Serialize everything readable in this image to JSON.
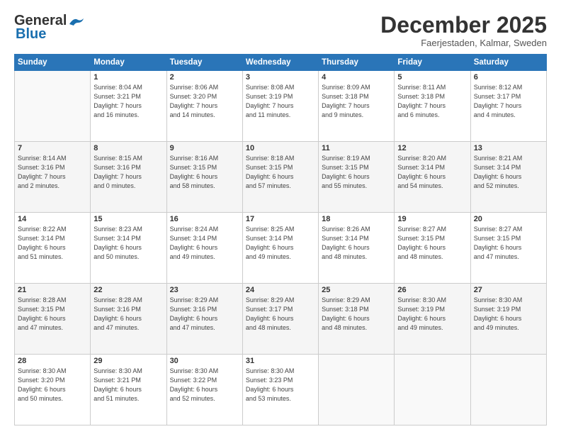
{
  "logo": {
    "line1": "General",
    "line2": "Blue"
  },
  "title": "December 2025",
  "location": "Faerjestaden, Kalmar, Sweden",
  "days_header": [
    "Sunday",
    "Monday",
    "Tuesday",
    "Wednesday",
    "Thursday",
    "Friday",
    "Saturday"
  ],
  "weeks": [
    [
      {
        "num": "",
        "info": ""
      },
      {
        "num": "1",
        "info": "Sunrise: 8:04 AM\nSunset: 3:21 PM\nDaylight: 7 hours\nand 16 minutes."
      },
      {
        "num": "2",
        "info": "Sunrise: 8:06 AM\nSunset: 3:20 PM\nDaylight: 7 hours\nand 14 minutes."
      },
      {
        "num": "3",
        "info": "Sunrise: 8:08 AM\nSunset: 3:19 PM\nDaylight: 7 hours\nand 11 minutes."
      },
      {
        "num": "4",
        "info": "Sunrise: 8:09 AM\nSunset: 3:18 PM\nDaylight: 7 hours\nand 9 minutes."
      },
      {
        "num": "5",
        "info": "Sunrise: 8:11 AM\nSunset: 3:18 PM\nDaylight: 7 hours\nand 6 minutes."
      },
      {
        "num": "6",
        "info": "Sunrise: 8:12 AM\nSunset: 3:17 PM\nDaylight: 7 hours\nand 4 minutes."
      }
    ],
    [
      {
        "num": "7",
        "info": "Sunrise: 8:14 AM\nSunset: 3:16 PM\nDaylight: 7 hours\nand 2 minutes."
      },
      {
        "num": "8",
        "info": "Sunrise: 8:15 AM\nSunset: 3:16 PM\nDaylight: 7 hours\nand 0 minutes."
      },
      {
        "num": "9",
        "info": "Sunrise: 8:16 AM\nSunset: 3:15 PM\nDaylight: 6 hours\nand 58 minutes."
      },
      {
        "num": "10",
        "info": "Sunrise: 8:18 AM\nSunset: 3:15 PM\nDaylight: 6 hours\nand 57 minutes."
      },
      {
        "num": "11",
        "info": "Sunrise: 8:19 AM\nSunset: 3:15 PM\nDaylight: 6 hours\nand 55 minutes."
      },
      {
        "num": "12",
        "info": "Sunrise: 8:20 AM\nSunset: 3:14 PM\nDaylight: 6 hours\nand 54 minutes."
      },
      {
        "num": "13",
        "info": "Sunrise: 8:21 AM\nSunset: 3:14 PM\nDaylight: 6 hours\nand 52 minutes."
      }
    ],
    [
      {
        "num": "14",
        "info": "Sunrise: 8:22 AM\nSunset: 3:14 PM\nDaylight: 6 hours\nand 51 minutes."
      },
      {
        "num": "15",
        "info": "Sunrise: 8:23 AM\nSunset: 3:14 PM\nDaylight: 6 hours\nand 50 minutes."
      },
      {
        "num": "16",
        "info": "Sunrise: 8:24 AM\nSunset: 3:14 PM\nDaylight: 6 hours\nand 49 minutes."
      },
      {
        "num": "17",
        "info": "Sunrise: 8:25 AM\nSunset: 3:14 PM\nDaylight: 6 hours\nand 49 minutes."
      },
      {
        "num": "18",
        "info": "Sunrise: 8:26 AM\nSunset: 3:14 PM\nDaylight: 6 hours\nand 48 minutes."
      },
      {
        "num": "19",
        "info": "Sunrise: 8:27 AM\nSunset: 3:15 PM\nDaylight: 6 hours\nand 48 minutes."
      },
      {
        "num": "20",
        "info": "Sunrise: 8:27 AM\nSunset: 3:15 PM\nDaylight: 6 hours\nand 47 minutes."
      }
    ],
    [
      {
        "num": "21",
        "info": "Sunrise: 8:28 AM\nSunset: 3:15 PM\nDaylight: 6 hours\nand 47 minutes."
      },
      {
        "num": "22",
        "info": "Sunrise: 8:28 AM\nSunset: 3:16 PM\nDaylight: 6 hours\nand 47 minutes."
      },
      {
        "num": "23",
        "info": "Sunrise: 8:29 AM\nSunset: 3:16 PM\nDaylight: 6 hours\nand 47 minutes."
      },
      {
        "num": "24",
        "info": "Sunrise: 8:29 AM\nSunset: 3:17 PM\nDaylight: 6 hours\nand 48 minutes."
      },
      {
        "num": "25",
        "info": "Sunrise: 8:29 AM\nSunset: 3:18 PM\nDaylight: 6 hours\nand 48 minutes."
      },
      {
        "num": "26",
        "info": "Sunrise: 8:30 AM\nSunset: 3:19 PM\nDaylight: 6 hours\nand 49 minutes."
      },
      {
        "num": "27",
        "info": "Sunrise: 8:30 AM\nSunset: 3:19 PM\nDaylight: 6 hours\nand 49 minutes."
      }
    ],
    [
      {
        "num": "28",
        "info": "Sunrise: 8:30 AM\nSunset: 3:20 PM\nDaylight: 6 hours\nand 50 minutes."
      },
      {
        "num": "29",
        "info": "Sunrise: 8:30 AM\nSunset: 3:21 PM\nDaylight: 6 hours\nand 51 minutes."
      },
      {
        "num": "30",
        "info": "Sunrise: 8:30 AM\nSunset: 3:22 PM\nDaylight: 6 hours\nand 52 minutes."
      },
      {
        "num": "31",
        "info": "Sunrise: 8:30 AM\nSunset: 3:23 PM\nDaylight: 6 hours\nand 53 minutes."
      },
      {
        "num": "",
        "info": ""
      },
      {
        "num": "",
        "info": ""
      },
      {
        "num": "",
        "info": ""
      }
    ]
  ]
}
